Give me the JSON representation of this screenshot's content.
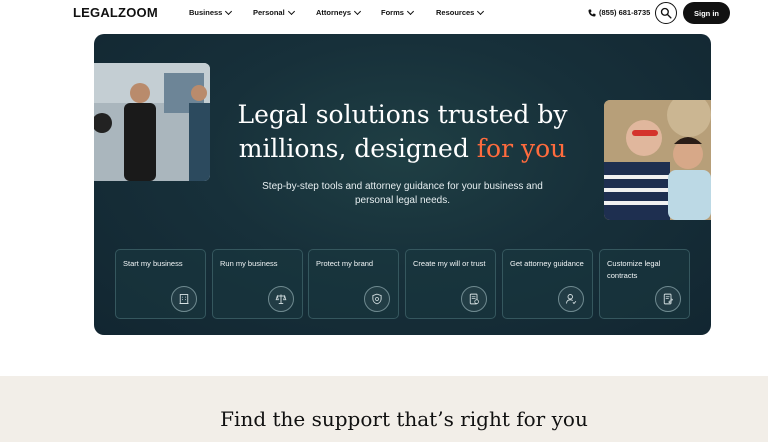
{
  "header": {
    "logo": "LEGALZOOM",
    "nav": [
      {
        "label": "Business"
      },
      {
        "label": "Personal"
      },
      {
        "label": "Attorneys"
      },
      {
        "label": "Forms"
      },
      {
        "label": "Resources"
      }
    ],
    "phone": "(855) 681-8735",
    "signin_label": "Sign in"
  },
  "hero": {
    "title_line1": "Legal solutions trusted by",
    "title_line2_plain": "millions, designed",
    "title_line2_accent": "for you",
    "subtitle": "Step-by-step tools and attorney guidance for your business and personal legal needs.",
    "cards": [
      {
        "label": "Start my business",
        "icon": "building-icon"
      },
      {
        "label": "Run my business",
        "icon": "scales-icon"
      },
      {
        "label": "Protect my brand",
        "icon": "shield-icon"
      },
      {
        "label": "Create my will or trust",
        "icon": "document-check-icon"
      },
      {
        "label": "Get attorney guidance",
        "icon": "attorney-icon"
      },
      {
        "label": "Customize legal contracts",
        "icon": "contract-icon"
      }
    ]
  },
  "support": {
    "title": "Find the support that’s right for you"
  },
  "colors": {
    "hero_bg": "#17303a",
    "accent": "#ff6b3d",
    "button_bg": "#111111"
  }
}
